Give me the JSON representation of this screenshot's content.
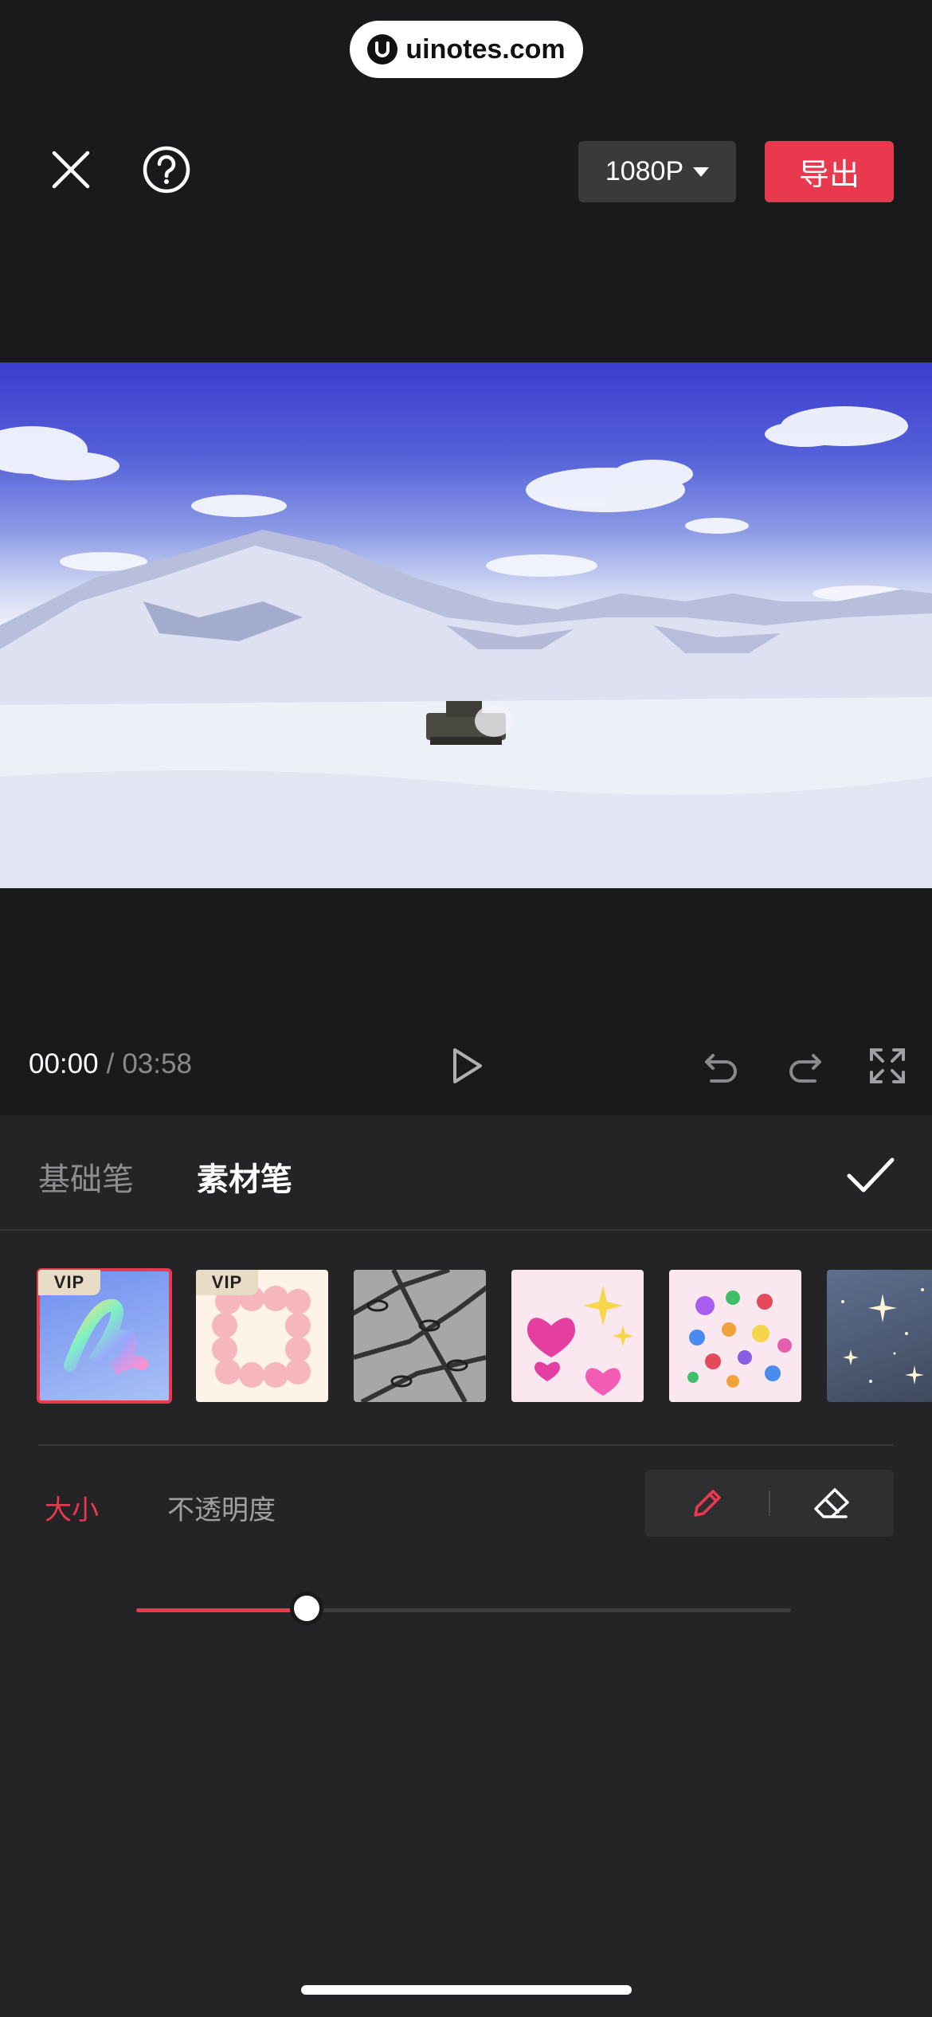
{
  "watermark": {
    "text": "uinotes.com"
  },
  "topbar": {
    "resolution": "1080P",
    "export_label": "导出"
  },
  "player": {
    "current_time": "00:00",
    "separator": "/",
    "total_time": "03:58"
  },
  "brush_tabs": {
    "basic": "基础笔",
    "material": "素材笔",
    "active": "素材笔"
  },
  "materials": [
    {
      "name": "rainbow-brush",
      "badge": "VIP",
      "selected": true
    },
    {
      "name": "pink-hearts-frame",
      "badge": "VIP",
      "selected": false
    },
    {
      "name": "chains",
      "badge": "",
      "selected": false
    },
    {
      "name": "heart-sparkles",
      "badge": "",
      "selected": false
    },
    {
      "name": "emoji-confetti",
      "badge": "",
      "selected": false
    },
    {
      "name": "starry-glitter",
      "badge": "",
      "selected": false
    }
  ],
  "adjust": {
    "size_label": "大小",
    "opacity_label": "不透明度",
    "active": "大小",
    "size_value_fraction": 0.26
  },
  "tools": {
    "active": "pen"
  },
  "colors": {
    "accent": "#e9394f",
    "background": "#1a1a1c",
    "panel": "#242426"
  }
}
